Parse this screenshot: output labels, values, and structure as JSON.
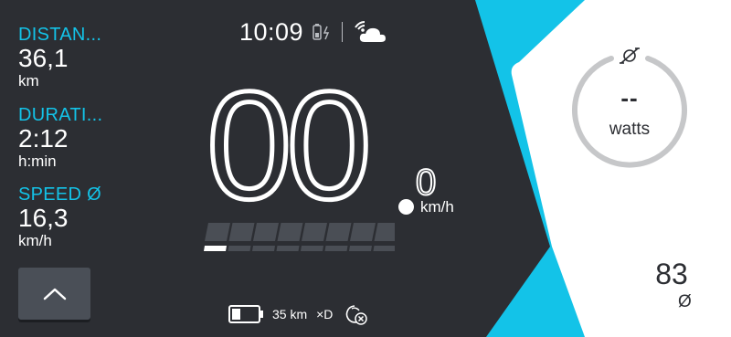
{
  "colors": {
    "background": "#2c2e33",
    "accent": "#13c3e8",
    "panel": "#ffffff",
    "assist_bar": "#4a4e55"
  },
  "trip": {
    "distance": {
      "label": "DISTAN...",
      "value": "36,1",
      "unit": "km"
    },
    "duration": {
      "label": "DURATI...",
      "value": "2:12",
      "unit": "h:min"
    },
    "avg_speed": {
      "label": "SPEED Ø",
      "value": "16,3",
      "unit": "km/h"
    }
  },
  "up_button": {
    "icon": "chevron-up-icon"
  },
  "status_bar": {
    "time": "10:09",
    "battery_icon": "phone-battery-charging-icon",
    "weather_icon": "connected-cloud-icon"
  },
  "speed": {
    "integer": "00",
    "decimal": "0",
    "unit": "km/h"
  },
  "assist": {
    "segments": 8,
    "active_segments": 1
  },
  "bottom_bar": {
    "battery_icon": "battery-icon",
    "range": "35 km",
    "light_label": "×D",
    "light_icon": "headlight-icon",
    "extra_icon": "assist-off-icon"
  },
  "power": {
    "value": "--",
    "unit": "watts",
    "icon": "pedal-power-icon"
  },
  "cadence": {
    "value": "83",
    "unit": "Ø"
  }
}
